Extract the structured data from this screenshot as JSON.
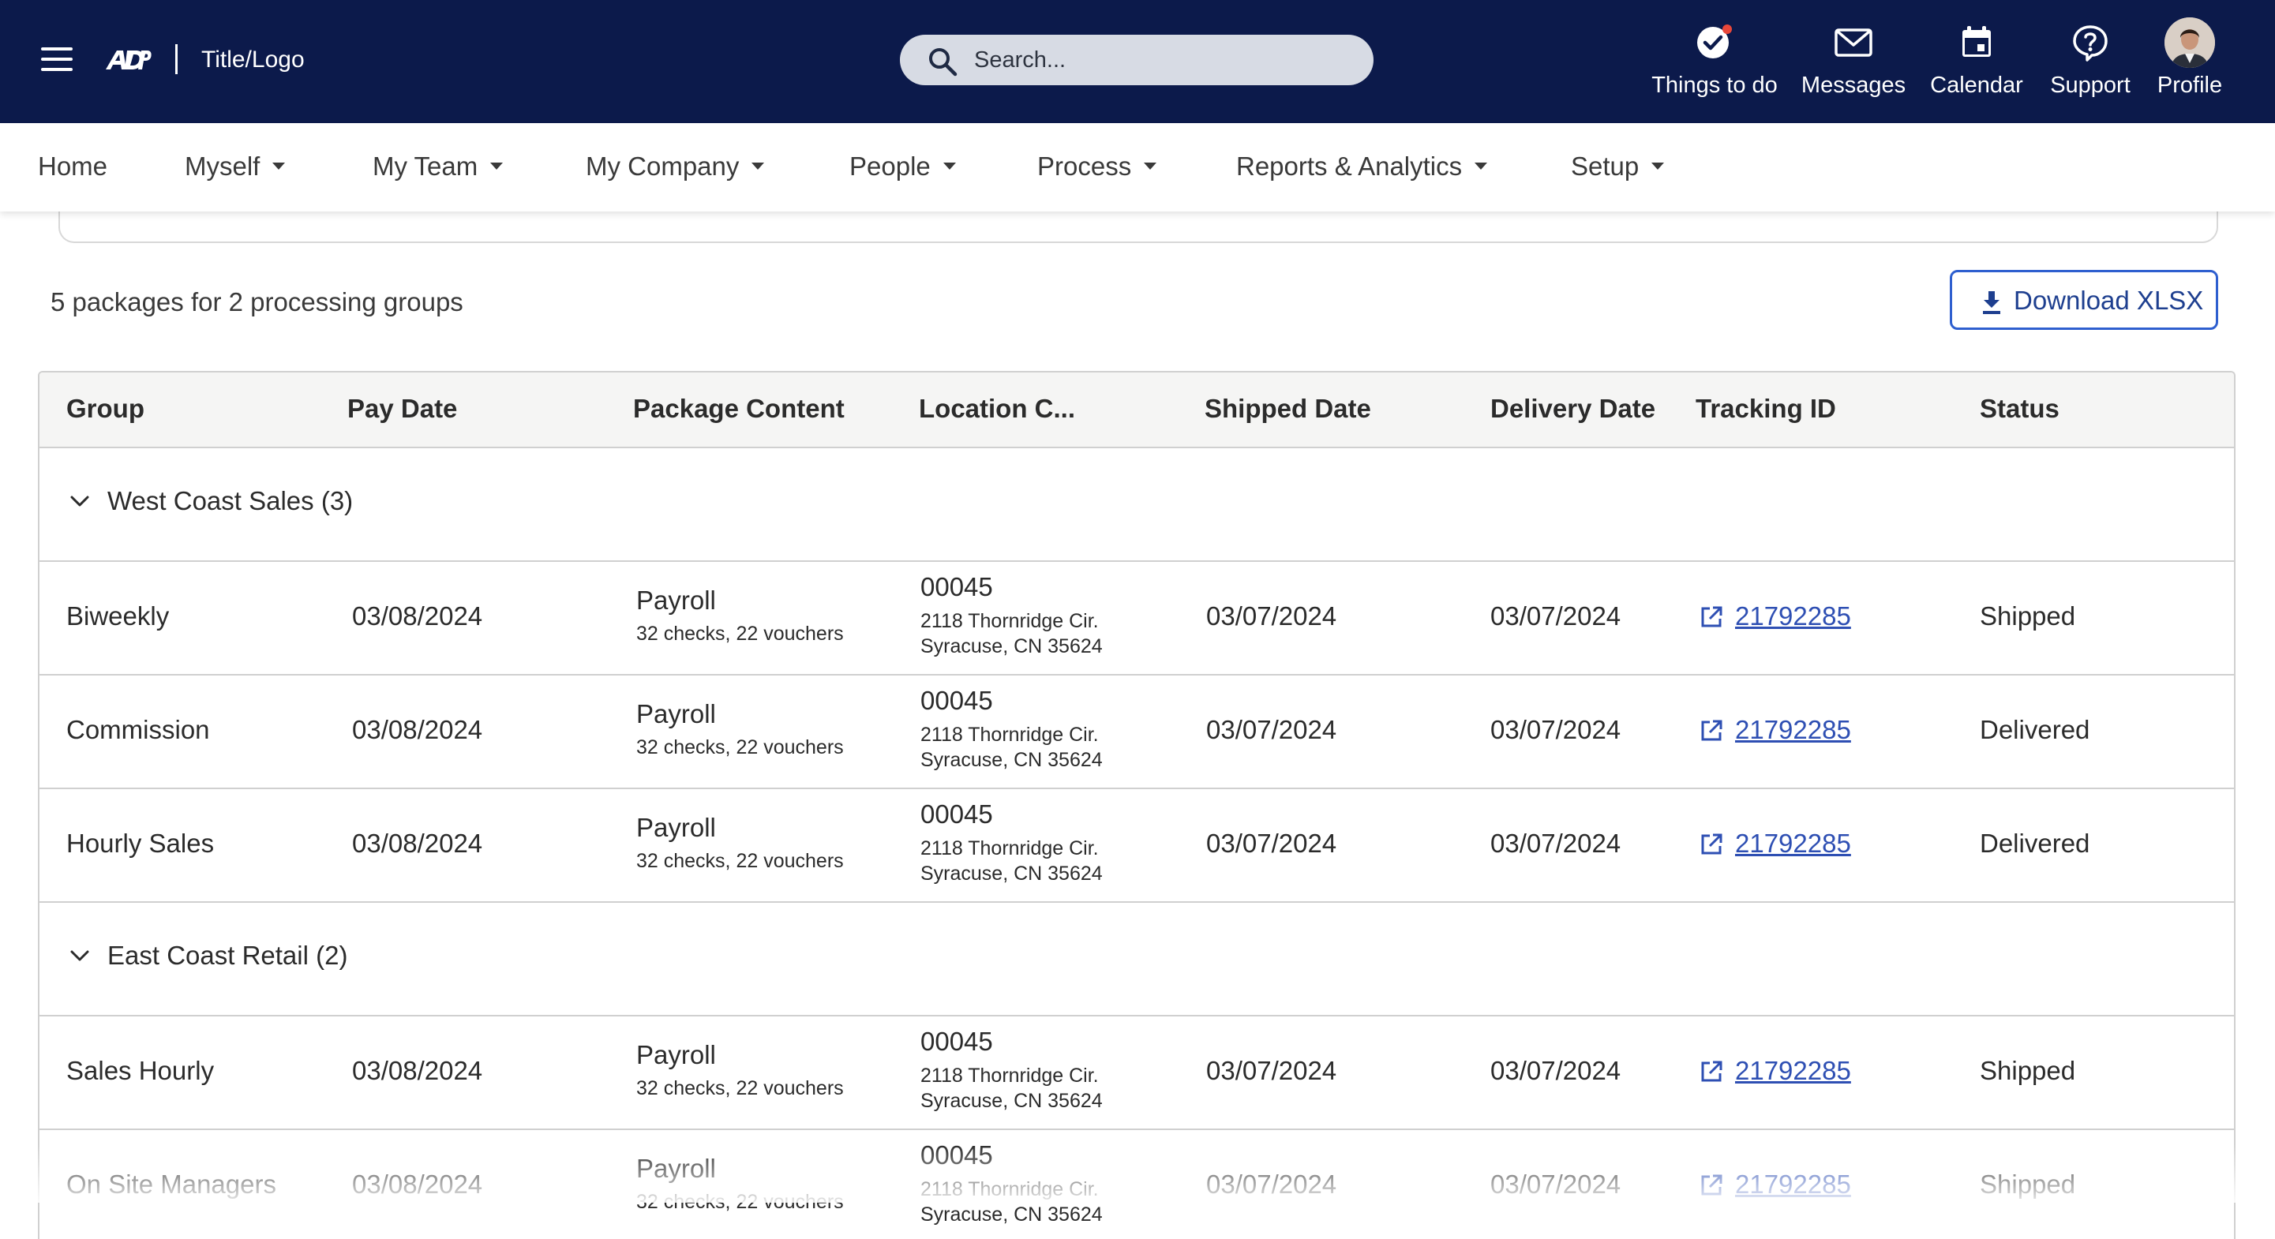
{
  "header": {
    "title": "Title/Logo",
    "search_placeholder": "Search...",
    "nav": [
      {
        "label": "Things to do",
        "icon": "check-circle-icon"
      },
      {
        "label": "Messages",
        "icon": "envelope-icon"
      },
      {
        "label": "Calendar",
        "icon": "calendar-icon"
      },
      {
        "label": "Support",
        "icon": "help-icon"
      },
      {
        "label": "Profile",
        "icon": "avatar"
      }
    ],
    "notification_color": "#e8473a",
    "bar_color": "#0c1a4b"
  },
  "menu": [
    {
      "label": "Home"
    },
    {
      "label": "Myself"
    },
    {
      "label": "My Team"
    },
    {
      "label": "My Company"
    },
    {
      "label": "People"
    },
    {
      "label": "Process"
    },
    {
      "label": "Reports & Analytics"
    },
    {
      "label": "Setup"
    }
  ],
  "summary": "5 packages for 2 processing groups",
  "download_label": "Download XLSX",
  "table": {
    "columns": [
      "Group",
      "Pay Date",
      "Package Content",
      "Location C...",
      "Shipped Date",
      "Delivery Date",
      "Tracking ID",
      "Status"
    ],
    "groups": [
      {
        "label": "West Coast Sales (3)",
        "rows": [
          {
            "group": "Biweekly",
            "pay_date": "03/08/2024",
            "package": "Payroll",
            "package_detail": "32 checks, 22 vouchers",
            "loc_code": "00045",
            "loc_line1": "2118 Thornridge Cir.",
            "loc_line2": "Syracuse, CN 35624",
            "shipped": "03/07/2024",
            "delivery": "03/07/2024",
            "tracking": "21792285",
            "status": "Shipped"
          },
          {
            "group": "Commission",
            "pay_date": "03/08/2024",
            "package": "Payroll",
            "package_detail": "32 checks, 22 vouchers",
            "loc_code": "00045",
            "loc_line1": "2118 Thornridge Cir.",
            "loc_line2": "Syracuse, CN 35624",
            "shipped": "03/07/2024",
            "delivery": "03/07/2024",
            "tracking": "21792285",
            "status": "Delivered"
          },
          {
            "group": "Hourly Sales",
            "pay_date": "03/08/2024",
            "package": "Payroll",
            "package_detail": "32 checks, 22 vouchers",
            "loc_code": "00045",
            "loc_line1": "2118 Thornridge Cir.",
            "loc_line2": "Syracuse, CN 35624",
            "shipped": "03/07/2024",
            "delivery": "03/07/2024",
            "tracking": "21792285",
            "status": "Delivered"
          }
        ]
      },
      {
        "label": "East Coast Retail (2)",
        "rows": [
          {
            "group": "Sales Hourly",
            "pay_date": "03/08/2024",
            "package": "Payroll",
            "package_detail": "32 checks, 22 vouchers",
            "loc_code": "00045",
            "loc_line1": "2118 Thornridge Cir.",
            "loc_line2": "Syracuse, CN 35624",
            "shipped": "03/07/2024",
            "delivery": "03/07/2024",
            "tracking": "21792285",
            "status": "Shipped"
          },
          {
            "group": "On Site Managers",
            "pay_date": "03/08/2024",
            "package": "Payroll",
            "package_detail": "32 checks, 22 vouchers",
            "loc_code": "00045",
            "loc_line1": "2118 Thornridge Cir.",
            "loc_line2": "Syracuse, CN 35624",
            "shipped": "03/07/2024",
            "delivery": "03/07/2024",
            "tracking": "21792285",
            "status": "Shipped"
          }
        ]
      }
    ]
  }
}
